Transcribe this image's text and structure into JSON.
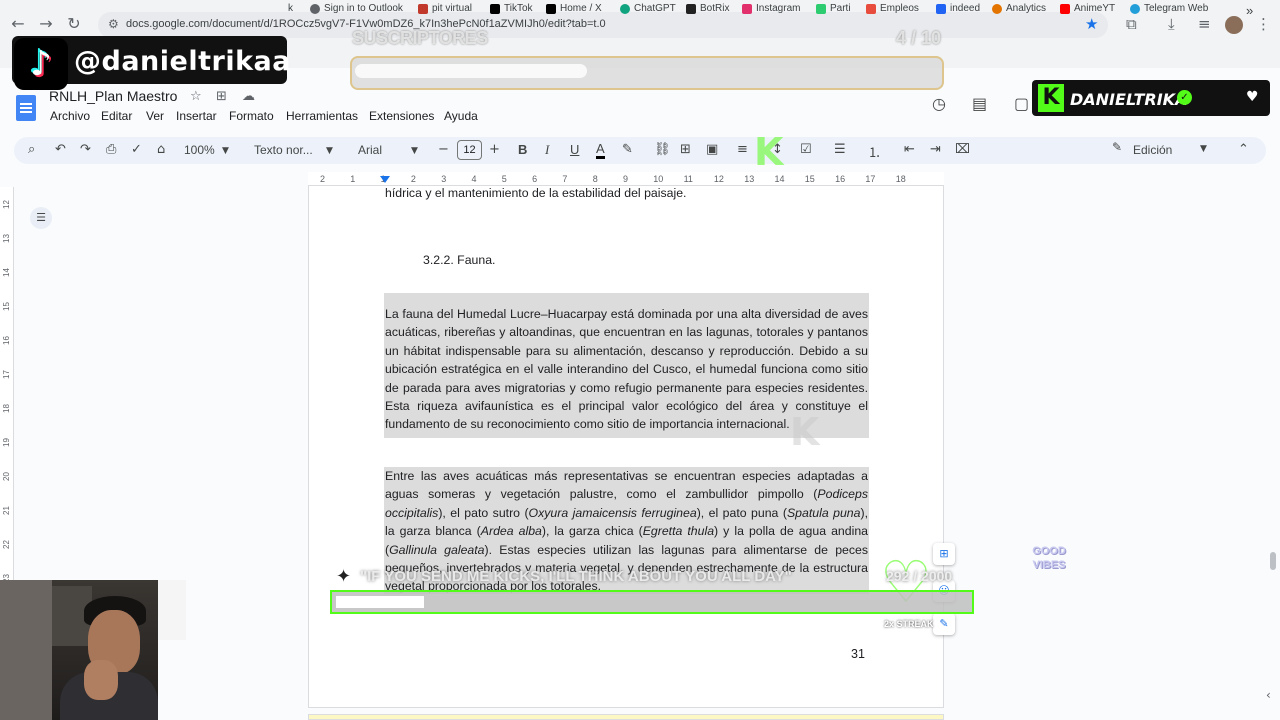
{
  "browser": {
    "url": "docs.google.com/document/d/1ROCcz5vgV7-F1Vw0mDZ6_k7In3hePcN0f1aZVMIJh0/edit?tab=t.0",
    "bookmarks": [
      "k",
      "Sign in to Outlook",
      "pit virtual",
      "TikTok",
      "Home / X",
      "ChatGPT",
      "BotRix",
      "Instagram",
      "Parti",
      "Empleos",
      "indeed",
      "Analytics",
      "AnimeYT",
      "Telegram Web"
    ]
  },
  "docs": {
    "title": "RNLH_Plan Maestro",
    "menus": [
      "Archivo",
      "Editar",
      "Ver",
      "Insertar",
      "Formato",
      "Herramientas",
      "Extensiones",
      "Ayuda"
    ],
    "toolbar": {
      "zoom": "100%",
      "style": "Texto nor...",
      "font": "Arial",
      "font_size": "12",
      "mode": "Edición"
    },
    "ruler_numbers": [
      "2",
      "1",
      "1",
      "2",
      "3",
      "4",
      "5",
      "6",
      "7",
      "8",
      "9",
      "10",
      "11",
      "12",
      "13",
      "14",
      "15",
      "16",
      "17",
      "18"
    ],
    "vruler_numbers": [
      "12",
      "13",
      "14",
      "15",
      "16",
      "17",
      "18",
      "19",
      "20",
      "21",
      "22",
      "23"
    ]
  },
  "document": {
    "top_line": "hídrica y el mantenimiento de la estabilidad del paisaje.",
    "heading": "3.2.2. Fauna.",
    "para1": "La fauna del Humedal Lucre–Huacarpay está dominada por una alta diversidad de aves acuáticas, ribereñas y altoandinas, que encuentran en las lagunas, totorales y pantanos un hábitat indispensable para su alimentación, descanso y reproducción. Debido a su ubicación estratégica en el valle interandino del Cusco, el humedal funciona como sitio de parada para aves migratorias y como refugio permanente para especies residentes. Esta riqueza avifaunística es el principal valor ecológico del área y constituye el fundamento de su reconocimiento como sitio de importancia internacional.",
    "para2": {
      "t1": "Entre las aves acuáticas más representativas se encuentran especies adaptadas a aguas someras y vegetación palustre, como el zambullidor pimpollo (",
      "i1": "Podiceps occipitalis",
      "t2": "), el pato sutro (",
      "i2": "Oxyura jamaicensis ferruginea",
      "t3": "), el pato puna (",
      "i3": "Spatula puna",
      "t4": "), la garza blanca (",
      "i4": "Ardea alba",
      "t5": "), la garza chica (",
      "i5": "Egretta thula",
      "t6": ") y la polla de agua andina (",
      "i6": "Gallinula galeata",
      "t7": "). Estas especies utilizan las lagunas para alimentarse de peces pequeños, invertebrados y materia vegetal, y dependen estrechamente de la estructura vegetal proporcionada por los totorales."
    },
    "page_number": "31"
  },
  "overlay": {
    "tiktok_handle": "@danieltrikaa",
    "subs_label": "SUSCRIPTORES",
    "subs_count": "4 / 10",
    "subs_progress": 0.4,
    "kick_name": "DANIELTRIKA",
    "kicks_message": "\"IF YOU SEND ME KICKS, I'LL THINK ABOUT YOU ALL DAY\"",
    "kicks_count": "292 / 2000",
    "kicks_progress": 0.146,
    "streak": "2x STREAK",
    "good_vibes": "GOOD VIBES"
  },
  "colors": {
    "kick_green": "#53fc18",
    "docs_blue": "#1a73e8",
    "highlight_gray": "#dcdcdc"
  }
}
